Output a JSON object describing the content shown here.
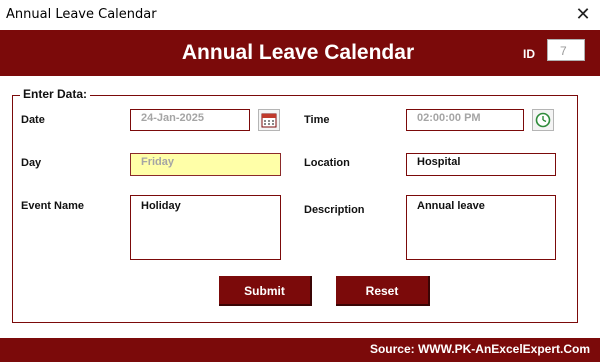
{
  "window": {
    "title": "Annual Leave Calendar",
    "close_label": "✕"
  },
  "header": {
    "title": "Annual Leave Calendar",
    "id_label": "ID",
    "id_value": "7"
  },
  "form": {
    "legend": "Enter Data:",
    "date": {
      "label": "Date",
      "value": "24-Jan-2025",
      "icon": "calendar-icon"
    },
    "time": {
      "label": "Time",
      "value": "02:00:00 PM",
      "icon": "clock-icon"
    },
    "day": {
      "label": "Day",
      "value": "Friday"
    },
    "location": {
      "label": "Location",
      "value": "Hospital"
    },
    "event_name": {
      "label": "Event Name",
      "value": "Holiday"
    },
    "description": {
      "label": "Description",
      "value": "Annual leave"
    },
    "submit_label": "Submit",
    "reset_label": "Reset"
  },
  "footer": {
    "source": "Source: WWW.PK-AnExcelExpert.Com"
  },
  "colors": {
    "brand": "#7b0a0a",
    "day_field_bg": "#ffffa8"
  }
}
